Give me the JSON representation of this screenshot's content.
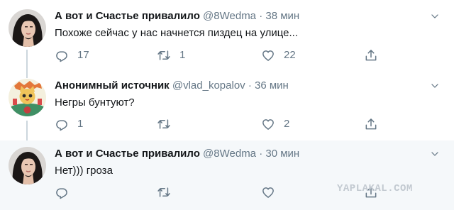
{
  "tweets": [
    {
      "name": "А вот и Счастье привалило",
      "handle": "@8Wedma",
      "dot": "·",
      "time": "38 мин",
      "text": "Похоже сейчас у нас начнется пиздец на улице...",
      "replies": "17",
      "retweets": "1",
      "likes": "22",
      "avatar_icon": "avatar-woman-photo"
    },
    {
      "name": "Анонимный источник",
      "handle": "@vlad_kopalov",
      "dot": "·",
      "time": "36 мин",
      "text": "Негры бунтуют?",
      "replies": "1",
      "retweets": "",
      "likes": "2",
      "avatar_icon": "avatar-cat-illustration"
    },
    {
      "name": "А вот и Счастье привалило",
      "handle": "@8Wedma",
      "dot": "·",
      "time": "30 мин",
      "text": "Нет))) гроза",
      "replies": "",
      "retweets": "",
      "likes": "",
      "avatar_icon": "avatar-woman-photo"
    }
  ],
  "watermark": "YAPLAKAL.COM",
  "icons": [
    "reply-icon",
    "retweet-icon",
    "like-icon",
    "share-icon",
    "caret-down-icon"
  ],
  "colors": {
    "text": "#14171a",
    "secondary": "#657786",
    "thread_line": "#ccd6dd",
    "highlight_bg": "#f5f8fa",
    "watermark": "#c2c9d0"
  }
}
